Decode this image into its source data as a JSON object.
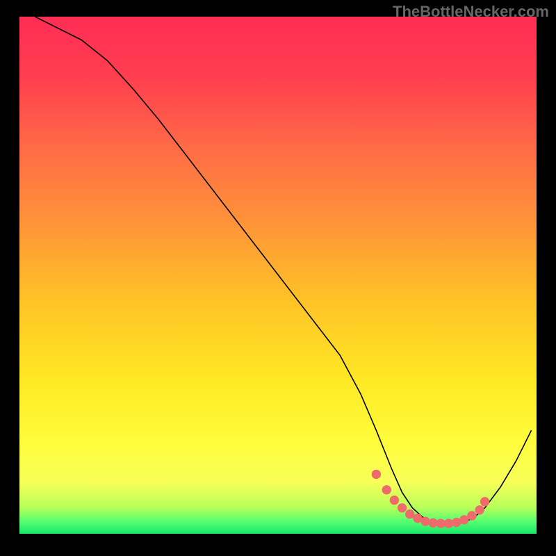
{
  "watermark": "TheBottleNecker.com",
  "colors": {
    "bg": "#000000",
    "gradient_stops": [
      {
        "offset": 0.0,
        "color": "#ff2d55"
      },
      {
        "offset": 0.12,
        "color": "#ff3f4f"
      },
      {
        "offset": 0.25,
        "color": "#ff6a47"
      },
      {
        "offset": 0.4,
        "color": "#ff9438"
      },
      {
        "offset": 0.55,
        "color": "#ffc326"
      },
      {
        "offset": 0.7,
        "color": "#ffe824"
      },
      {
        "offset": 0.82,
        "color": "#fffc3a"
      },
      {
        "offset": 0.9,
        "color": "#f8ff58"
      },
      {
        "offset": 0.95,
        "color": "#b7ff5a"
      },
      {
        "offset": 0.975,
        "color": "#5aff70"
      },
      {
        "offset": 1.0,
        "color": "#17e86a"
      }
    ],
    "curve": "#000000",
    "markers": "#ef6a6a"
  },
  "chart_data": {
    "type": "line",
    "title": "",
    "xlabel": "",
    "ylabel": "",
    "xlim": [
      0,
      100
    ],
    "ylim": [
      0,
      100
    ],
    "series": [
      {
        "name": "bottleneck-curve",
        "x": [
          3,
          7,
          12,
          17,
          22,
          27,
          32,
          37,
          42,
          47,
          52,
          57,
          62,
          66,
          69,
          72,
          74,
          76,
          78,
          80,
          82,
          84,
          86,
          88,
          90,
          93,
          96,
          99
        ],
        "y": [
          100,
          98,
          95.5,
          91.5,
          86,
          80,
          73.5,
          67,
          60.5,
          54,
          47.5,
          41,
          34.5,
          27,
          20,
          12.5,
          8,
          5,
          3.2,
          2.2,
          1.8,
          1.8,
          2.2,
          3.2,
          5,
          9,
          14,
          20
        ]
      }
    ],
    "markers": {
      "name": "highlight-dots",
      "x": [
        69,
        71,
        72.5,
        74,
        75.5,
        77,
        78.5,
        80,
        81.5,
        83,
        84.5,
        86,
        87.5,
        89,
        90
      ],
      "y": [
        11.5,
        8.5,
        6.5,
        5.0,
        3.8,
        3.0,
        2.4,
        2.1,
        2.0,
        2.0,
        2.2,
        2.7,
        3.5,
        4.6,
        6.2
      ]
    }
  }
}
